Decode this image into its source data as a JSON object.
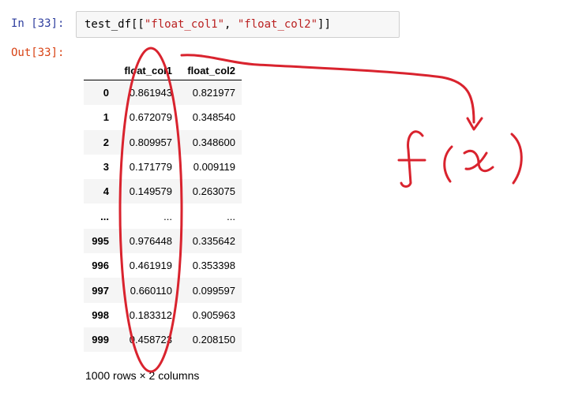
{
  "cell": {
    "in_prompt": "In [33]:",
    "out_prompt": "Out[33]:",
    "code_prefix": "test_df[[",
    "code_str1": "\"float_col1\"",
    "code_sep": ", ",
    "code_str2": "\"float_col2\"",
    "code_suffix": "]]"
  },
  "dataframe": {
    "columns": [
      "float_col1",
      "float_col2"
    ],
    "rows": [
      {
        "index": "0",
        "c1": "0.861943",
        "c2": "0.821977"
      },
      {
        "index": "1",
        "c1": "0.672079",
        "c2": "0.348540"
      },
      {
        "index": "2",
        "c1": "0.809957",
        "c2": "0.348600"
      },
      {
        "index": "3",
        "c1": "0.171779",
        "c2": "0.009119"
      },
      {
        "index": "4",
        "c1": "0.149579",
        "c2": "0.263075"
      },
      {
        "index": "...",
        "c1": "...",
        "c2": "..."
      },
      {
        "index": "995",
        "c1": "0.976448",
        "c2": "0.335642"
      },
      {
        "index": "996",
        "c1": "0.461919",
        "c2": "0.353398"
      },
      {
        "index": "997",
        "c1": "0.660110",
        "c2": "0.099597"
      },
      {
        "index": "998",
        "c1": "0.183312",
        "c2": "0.905963"
      },
      {
        "index": "999",
        "c1": "0.458723",
        "c2": "0.208150"
      }
    ],
    "summary": "1000 rows × 2 columns"
  },
  "annotation": {
    "color": "#d9232e"
  }
}
